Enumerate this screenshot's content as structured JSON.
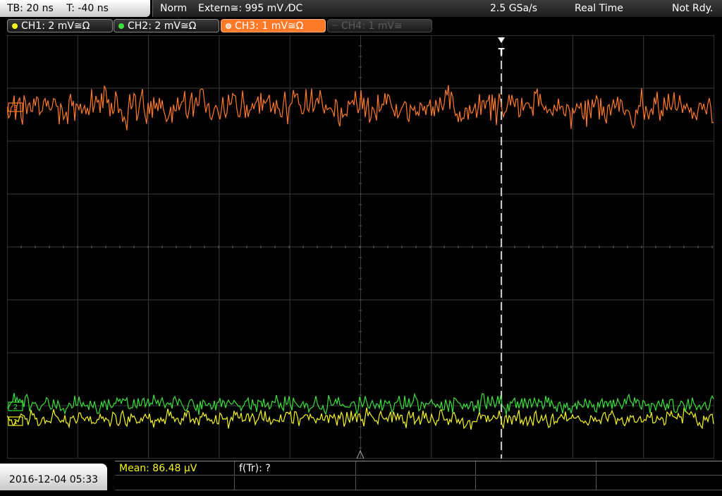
{
  "timebase": {
    "tb": "TB: 20 ns",
    "trigger_offset": "T: -40 ns"
  },
  "infobar": {
    "mode": "Norm",
    "trigger": "Extern≅: 995 mV ⁄DC",
    "sample_rate": "2.5 GSa/s",
    "acq_mode": "Real Time",
    "status": "Not Rdy."
  },
  "channels": [
    {
      "label": "CH1: 2 mV≅Ω",
      "color": "#f5f51e",
      "state": "on"
    },
    {
      "label": "CH2: 2 mV≅Ω",
      "color": "#3ce03c",
      "state": "on"
    },
    {
      "label": "CH3: 1 mV≅Ω",
      "color": "#ff7a28",
      "state": "selected"
    },
    {
      "label": "CH4: 1 mV≅",
      "color": "#5a5a5a",
      "state": "off"
    }
  ],
  "markers": {
    "trigger": "T",
    "ch1": "1",
    "ch2": "2",
    "ch3": "3"
  },
  "bottom": {
    "datetime": "2016-12-04 05:33",
    "measurements": [
      {
        "label": "Mean: 86.48 µV",
        "color": "#f5f51e"
      },
      {
        "label": "f(Tr): ?",
        "color": "#ffffff"
      }
    ]
  },
  "colors": {
    "grid": "#3a3a3a",
    "ch3_trace": "#ff7a28",
    "ch2_trace": "#3ce03c",
    "ch1_trace": "#f5f51e"
  }
}
